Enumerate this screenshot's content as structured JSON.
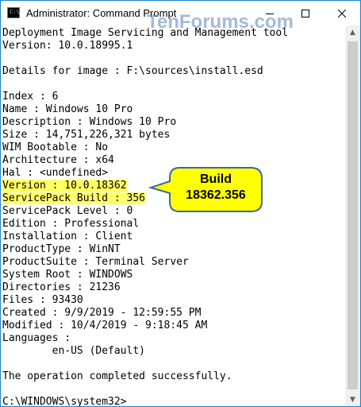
{
  "window": {
    "title": "Administrator: Command Prompt",
    "icon": "cmd-icon",
    "border_color": "#1883d7"
  },
  "watermark": "TenForums.com",
  "console": {
    "lines": [
      "Deployment Image Servicing and Management tool",
      "Version: 10.0.18995.1",
      "",
      "Details for image : F:\\sources\\install.esd",
      "",
      "Index : 6",
      "Name : Windows 10 Pro",
      "Description : Windows 10 Pro",
      "Size : 14,751,226,321 bytes",
      "WIM Bootable : No",
      "Architecture : x64",
      "Hal : <undefined>",
      "Version : 10.0.18362",
      "ServicePack Build : 356",
      "ServicePack Level : 0",
      "Edition : Professional",
      "Installation : Client",
      "ProductType : WinNT",
      "ProductSuite : Terminal Server",
      "System Root : WINDOWS",
      "Directories : 21236",
      "Files : 93430",
      "Created : 9/9/2019 - 12:59:55 PM",
      "Modified : 10/4/2019 - 9:18:45 AM",
      "Languages :",
      "        en-US (Default)",
      "",
      "The operation completed successfully.",
      "",
      "C:\\WINDOWS\\system32>"
    ],
    "highlighted_lines": [
      12,
      13
    ],
    "highlight_color": "#ffff66"
  },
  "callout": {
    "line1": "Build",
    "line2": "18362.356",
    "fill": "#ffff00"
  }
}
